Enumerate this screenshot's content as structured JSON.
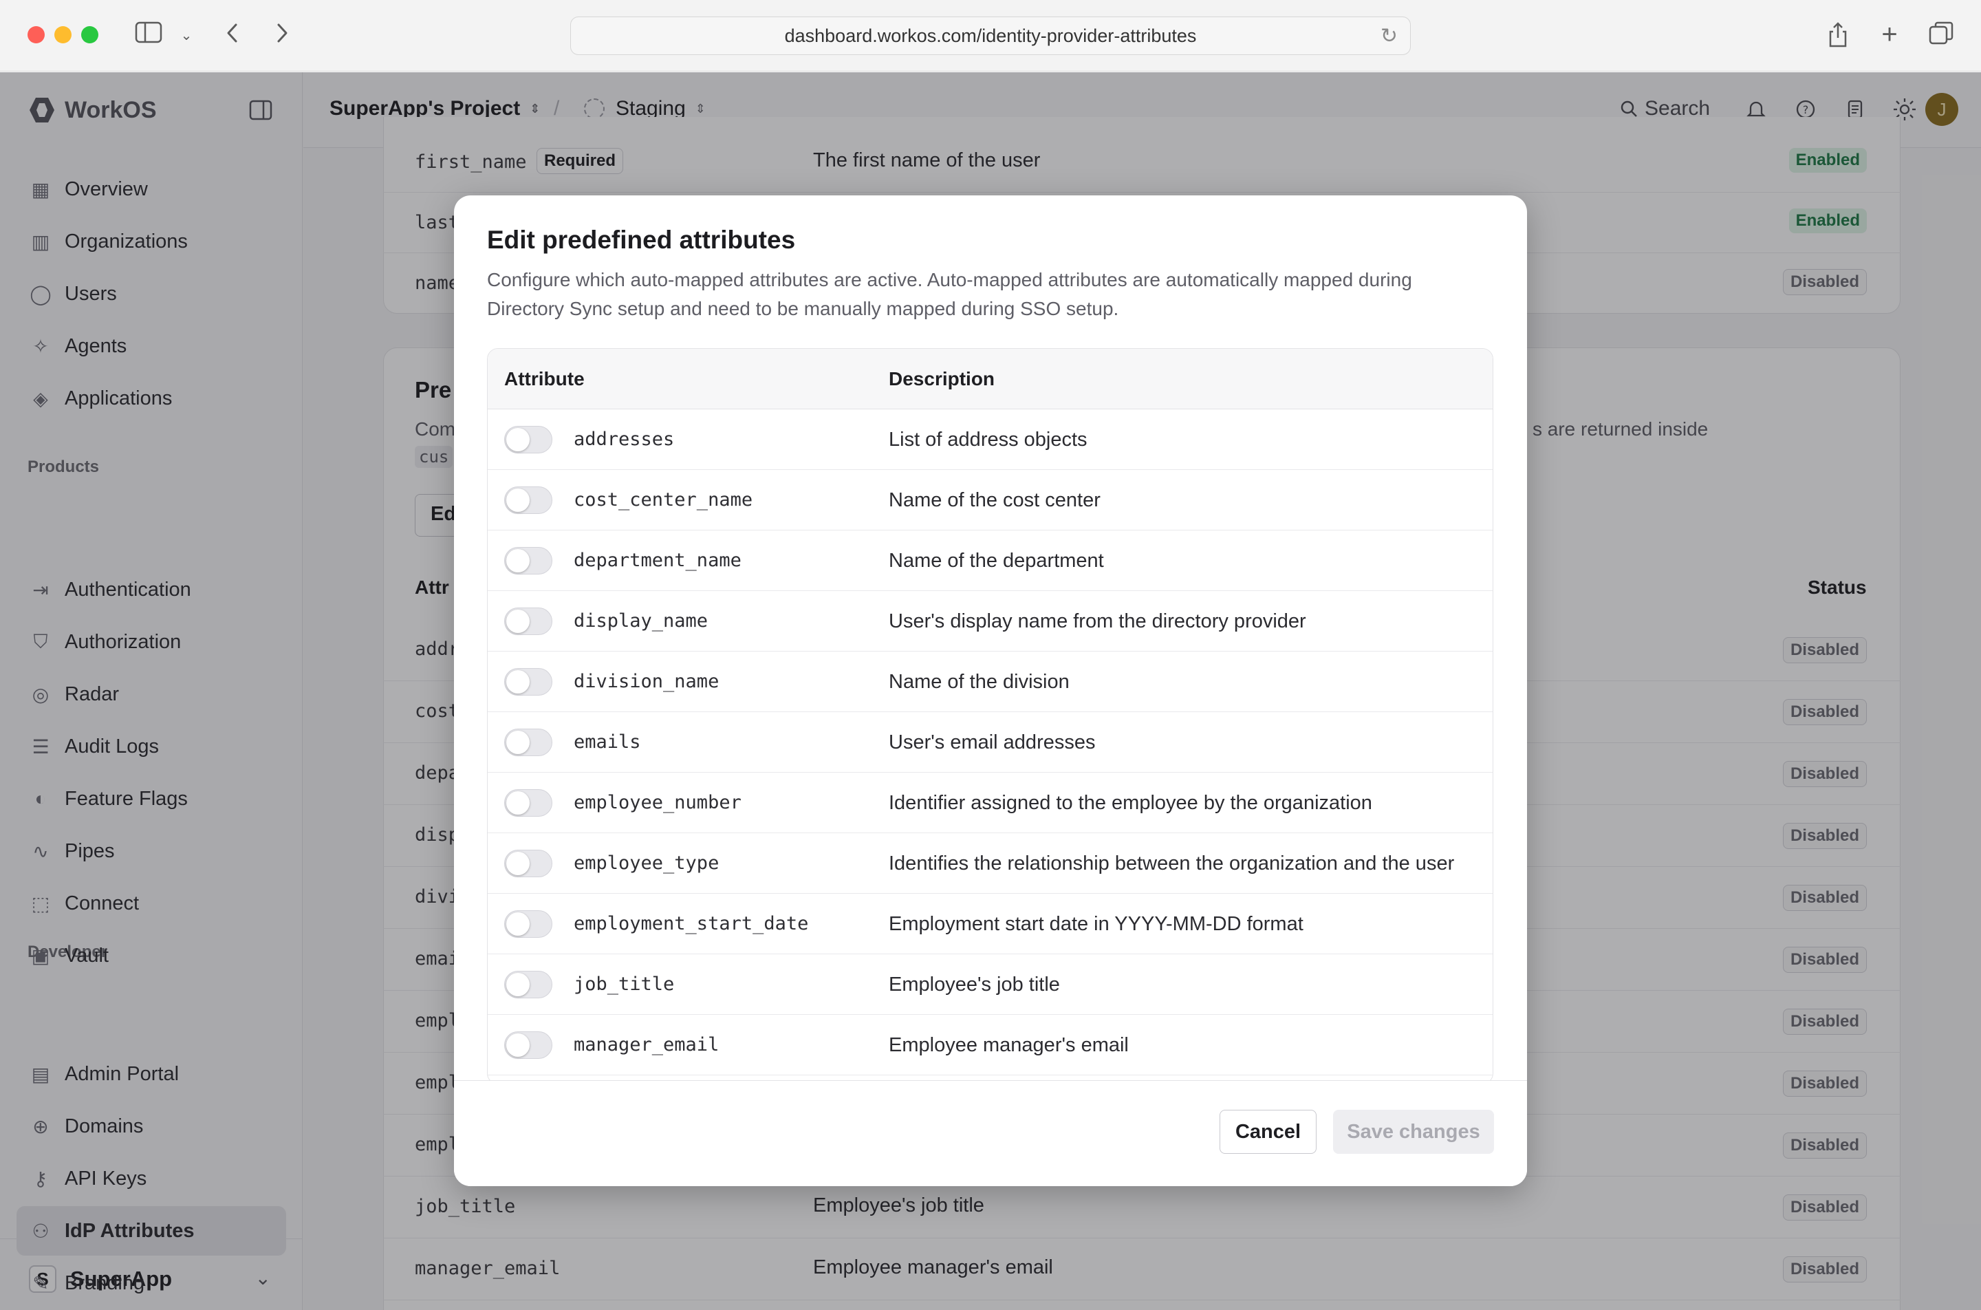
{
  "browser": {
    "url": "dashboard.workos.com/identity-provider-attributes"
  },
  "brand": {
    "name": "WorkOS"
  },
  "breadcrumb": {
    "project": "SuperApp's Project",
    "separator": "/",
    "environment": "Staging"
  },
  "topbar": {
    "search_label": "Search",
    "avatar_initial": "J"
  },
  "sidebar": {
    "main": [
      {
        "label": "Overview",
        "icon": "grid-icon"
      },
      {
        "label": "Organizations",
        "icon": "building-icon"
      },
      {
        "label": "Users",
        "icon": "user-icon"
      },
      {
        "label": "Agents",
        "icon": "sparkle-icon"
      },
      {
        "label": "Applications",
        "icon": "layers-icon"
      }
    ],
    "products_label": "Products",
    "products": [
      {
        "label": "Authentication",
        "icon": "login-icon"
      },
      {
        "label": "Authorization",
        "icon": "shield-icon"
      },
      {
        "label": "Radar",
        "icon": "radar-icon"
      },
      {
        "label": "Audit Logs",
        "icon": "log-icon"
      },
      {
        "label": "Feature Flags",
        "icon": "toggle-icon"
      },
      {
        "label": "Pipes",
        "icon": "pipes-icon"
      },
      {
        "label": "Connect",
        "icon": "connect-icon"
      },
      {
        "label": "Vault",
        "icon": "vault-icon"
      }
    ],
    "developer_label": "Developer",
    "developer": [
      {
        "label": "Admin Portal",
        "icon": "portal-icon"
      },
      {
        "label": "Domains",
        "icon": "globe-icon"
      },
      {
        "label": "API Keys",
        "icon": "key-icon"
      },
      {
        "label": "IdP Attributes",
        "icon": "attributes-icon",
        "active": true
      },
      {
        "label": "Branding",
        "icon": "brush-icon"
      }
    ],
    "workspace": {
      "initial": "S",
      "name": "SuperApp"
    }
  },
  "background": {
    "top_rows": [
      {
        "attr": "first_name",
        "tag": "Required",
        "desc": "The first name of the user",
        "status": "Enabled"
      },
      {
        "attr": "last",
        "desc": "",
        "status": "Enabled"
      },
      {
        "attr": "name",
        "desc": "",
        "status": "Disabled"
      }
    ],
    "section_title_partial": "Pre",
    "section_desc_partial": "Com",
    "section_desc_right": "s are returned inside",
    "code_partial": "cus",
    "edit_btn_partial": "Ed",
    "col_attr_partial": "Attr",
    "col_status": "Status",
    "rows": [
      {
        "attr": "addr",
        "desc": "",
        "status": "Disabled"
      },
      {
        "attr": "cost",
        "desc": "",
        "status": "Disabled"
      },
      {
        "attr": "depa",
        "desc": "",
        "status": "Disabled"
      },
      {
        "attr": "disp",
        "desc": "",
        "status": "Disabled"
      },
      {
        "attr": "divi",
        "desc": "",
        "status": "Disabled"
      },
      {
        "attr": "emai",
        "desc": "",
        "status": "Disabled"
      },
      {
        "attr": "empl",
        "desc": "",
        "status": "Disabled"
      },
      {
        "attr": "empl",
        "desc": "",
        "status": "Disabled"
      },
      {
        "attr": "empl",
        "desc": "",
        "status": "Disabled"
      },
      {
        "attr": "job_title",
        "desc": "Employee's job title",
        "status": "Disabled"
      },
      {
        "attr": "manager_email",
        "desc": "Employee manager's email",
        "status": "Disabled"
      }
    ]
  },
  "modal": {
    "title": "Edit predefined attributes",
    "description": "Configure which auto-mapped attributes are active. Auto-mapped attributes are automatically mapped during Directory Sync setup and need to be manually mapped during SSO setup.",
    "col_attribute": "Attribute",
    "col_description": "Description",
    "rows": [
      {
        "attr": "addresses",
        "desc": "List of address objects",
        "enabled": false
      },
      {
        "attr": "cost_center_name",
        "desc": "Name of the cost center",
        "enabled": false
      },
      {
        "attr": "department_name",
        "desc": "Name of the department",
        "enabled": false
      },
      {
        "attr": "display_name",
        "desc": "User's display name from the directory provider",
        "enabled": false
      },
      {
        "attr": "division_name",
        "desc": "Name of the division",
        "enabled": false
      },
      {
        "attr": "emails",
        "desc": "User's email addresses",
        "enabled": false
      },
      {
        "attr": "employee_number",
        "desc": "Identifier assigned to the employee by the organization",
        "enabled": false
      },
      {
        "attr": "employee_type",
        "desc": "Identifies the relationship between the organization and the user",
        "enabled": false
      },
      {
        "attr": "employment_start_date",
        "desc": "Employment start date in YYYY-MM-DD format",
        "enabled": false
      },
      {
        "attr": "job_title",
        "desc": "Employee's job title",
        "enabled": false
      },
      {
        "attr": "manager_email",
        "desc": "Employee manager's email",
        "enabled": false
      }
    ],
    "cancel_label": "Cancel",
    "save_label": "Save changes"
  }
}
